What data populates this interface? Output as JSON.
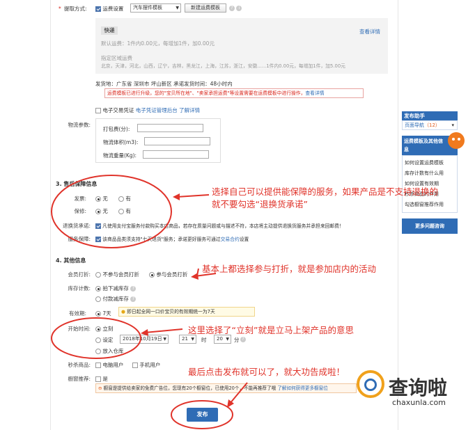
{
  "delivery": {
    "label": "提取方式:",
    "freight_option": "运费设置",
    "template_select": "汽车摆件模板",
    "new_template_btn": "新建运费模板",
    "express_tag": "快递",
    "view_detail": "查看详情",
    "default_fee": "默认运费：1件内0.00元，每增加1件，加0.00元",
    "region_title": "指定区域运费",
    "region_list": "北京，天津，河北，山西，辽宁，吉林，黑龙江，上海，江苏，浙江，安徽......1件内0.00元，每增加1件，加5.00元",
    "ship_from": "发货地：广东省 深圳市 坪山新区 承诺发货时间：48小时内",
    "notice": "运费模板已进行升级，您的\"宝贝所在地\"、\"卖家承担运费\"等设置需要在运费模板中进行操作，",
    "notice_link": "查看详情",
    "einvoice_label": "电子交易凭证",
    "einvoice_link": "电子凭证管理后台",
    "einvoice_more": "了解详情"
  },
  "logistics": {
    "label": "物流参数:",
    "pack_weight": "打包费(分):",
    "volume": "物流体积(m3):",
    "weight": "物流重量(Kg):"
  },
  "aftersale": {
    "section_title": "3. 售后保障信息",
    "invoice_label": "发票:",
    "warranty_label": "保修:",
    "opt_none": "无",
    "opt_yes": "有",
    "return_label": "退换货承诺:",
    "return_text": "凡使用支付宝服务付款购买本店商品，若存在质量问题或与描述不符，本店将主动提供退换货服务并承担来回邮费！",
    "service_label": "服务保障:",
    "service_text": "该商品品类须支持\"七天退货\"服务；承诺更好服务可通过",
    "service_link": "交易合约",
    "service_tail": "设置"
  },
  "other": {
    "section_title": "4. 其他信息",
    "member_label": "会员打折:",
    "member_no": "不参与会员打折",
    "member_yes": "参与会员打折",
    "stock_label": "库存计数:",
    "stock_a": "拍下减库存",
    "stock_b": "付款减库存",
    "valid_label": "有效期:",
    "valid_value": "7天",
    "valid_tip": "即日起全网一口价宝贝的有效期统一为7天",
    "launch_label": "开始时间:",
    "launch_now": "立刻",
    "launch_set": "设定",
    "launch_date": "2018年10月19日",
    "launch_hour": "21",
    "hour_unit": "时",
    "launch_min": "20",
    "min_unit": "分",
    "launch_store": "放入仓库",
    "seckill_label": "秒杀商品:",
    "seckill_pc": "电脑用户",
    "seckill_mobile": "手机用户",
    "window_label": "橱窗推荐:",
    "window_opt": "是",
    "window_note": "橱窗是提供给卖家的免费广告位，您现有20个橱窗位，已使用20个，不能再推荐了哦",
    "window_link": "了解如何获得更多橱窗位",
    "publish": "发布"
  },
  "sidebar": {
    "helper_title": "发布助手",
    "nav_label": "页面导航",
    "nav_count": "（12）",
    "topic": "运费模板及其他信息",
    "links": [
      "如何设置运费模板",
      "库存计数有什么用",
      "如何设置有效期",
      "秒杀商品的作用",
      "勾选橱窗推荐作用"
    ],
    "more_btn": "更多问题咨询"
  },
  "annotations": {
    "a1_line1": "选择自己可以提供能保障的服务，如果产品是不支持退换的",
    "a1_line2": "就不要勾选“退换货承诺”",
    "a2": "基本上都选择参与打折，就是参加店内的活动",
    "a3": "这里选择了“立刻”就是立马上架产品的意思",
    "a4": "最后点击发布就可以了，就大功告成啦！"
  },
  "watermark": {
    "brand": "查询啦",
    "url": "chaxunla.com"
  },
  "colors": {
    "accent": "#2f6cb5",
    "annotation": "#e0332a",
    "publish": "#2f6cb5"
  }
}
